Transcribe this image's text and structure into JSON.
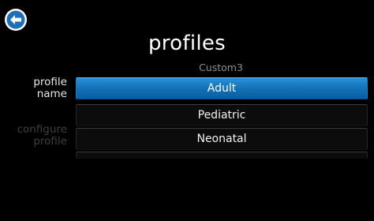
{
  "header": {
    "title": "profiles",
    "back_icon": "arrow-left-circle-icon"
  },
  "side_labels": {
    "profile_name": "profile\nname",
    "configure_profile": "configure\nprofile"
  },
  "profile_picker": {
    "partial_item": "Custom3",
    "selected_item": "Adult",
    "items": [
      "Pediatric",
      "Neonatal"
    ]
  },
  "colors": {
    "background": "#000000",
    "selection_blue": "#116fb5",
    "dim_text": "#3f3f3f"
  }
}
